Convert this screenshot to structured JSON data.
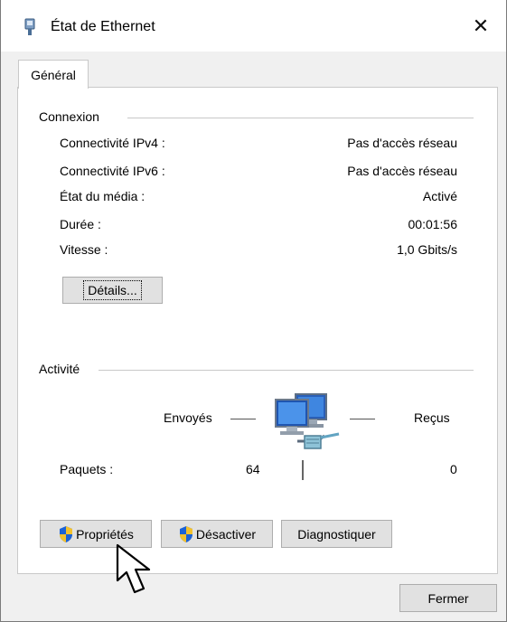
{
  "window": {
    "title": "État de Ethernet",
    "close_label": "✕"
  },
  "tabs": [
    {
      "label": "Général"
    }
  ],
  "connexion": {
    "group_label": "Connexion",
    "rows": [
      {
        "label": "Connectivité IPv4 :",
        "value": "Pas d'accès réseau"
      },
      {
        "label": "Connectivité IPv6 :",
        "value": "Pas d'accès réseau"
      },
      {
        "label": "État du média :",
        "value": "Activé"
      },
      {
        "label": "Durée :",
        "value": "00:01:56"
      },
      {
        "label": "Vitesse :",
        "value": "1,0 Gbits/s"
      }
    ],
    "details_button": "Détails..."
  },
  "activite": {
    "group_label": "Activité",
    "sent_label": "Envoyés",
    "received_label": "Reçus",
    "packets_label": "Paquets :",
    "packets_sent": "64",
    "packets_received": "0"
  },
  "buttons": {
    "properties": "Propriétés",
    "disable": "Désactiver",
    "diagnose": "Diagnostiquer",
    "close": "Fermer"
  },
  "icons": {
    "title": "ethernet-icon",
    "network": "network-computers-icon",
    "shield": "uac-shield-icon",
    "cursor": "mouse-pointer-icon"
  }
}
